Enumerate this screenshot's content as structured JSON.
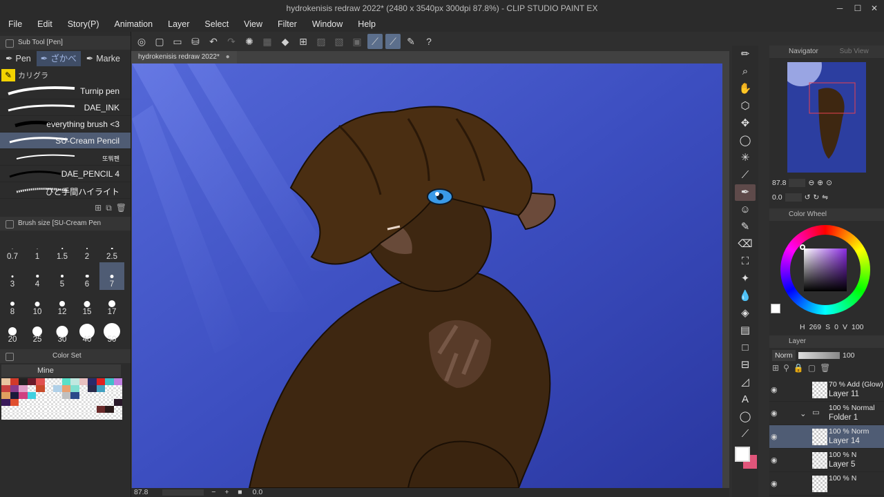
{
  "window": {
    "title": "hydrokenisis redraw 2022* (2480 x 3540px 300dpi 87.8%) - CLIP STUDIO PAINT EX",
    "min": "─",
    "max": "☐",
    "close": "✕"
  },
  "menu": [
    "File",
    "Edit",
    "Story(P)",
    "Animation",
    "Layer",
    "Select",
    "View",
    "Filter",
    "Window",
    "Help"
  ],
  "doc_tab": {
    "label": "hydrokenisis redraw 2022*",
    "close": "●"
  },
  "sub_tool": {
    "header": "Sub Tool [Pen]",
    "tabs": [
      "Pen",
      "ざかべ",
      "Marke"
    ],
    "group": "カリグラ",
    "brushes": [
      "Turnip pen",
      "DAE_INK",
      "everything brush <3",
      "SU-Cream Pencil",
      "또뭐펜",
      "DAE_PENCIL 4",
      "ひと手間ハイライト"
    ]
  },
  "brush_size": {
    "header": "Brush size [SU-Cream Pen",
    "sizes": [
      "0.7",
      "1",
      "1.5",
      "2",
      "2.5",
      "3",
      "4",
      "5",
      "6",
      "7",
      "8",
      "10",
      "12",
      "15",
      "17",
      "20",
      "25",
      "30",
      "40",
      "50"
    ],
    "selected": "7"
  },
  "color_set": {
    "header": "Color Set",
    "set_name": "Mine"
  },
  "status": {
    "zoom": "87.8",
    "angle": "0.0"
  },
  "navigator": {
    "tab1": "Navigator",
    "tab2": "Sub View",
    "zoom": "87.8",
    "angle": "0.0"
  },
  "color_wheel": {
    "header": "Color Wheel",
    "h": "269",
    "s": "0",
    "v": "100"
  },
  "layer_panel": {
    "header": "Layer",
    "blend": "Norm",
    "opacity": "100",
    "layers": [
      {
        "mode": "70 % Add (Glow)",
        "name": "Layer 11"
      },
      {
        "mode": "100 % Normal",
        "name": "Folder 1"
      },
      {
        "mode": "100 % Norm",
        "name": "Layer 14"
      },
      {
        "mode": "100 % N",
        "name": "Layer 5"
      },
      {
        "mode": "100 % N",
        "name": ""
      }
    ]
  },
  "colors": {
    "accent": "#5c6f8c",
    "canvas_bg": "#3d4fc2",
    "fur": "#3e2711",
    "main_color": "#ffffff",
    "sub_color": "#e0557a"
  }
}
